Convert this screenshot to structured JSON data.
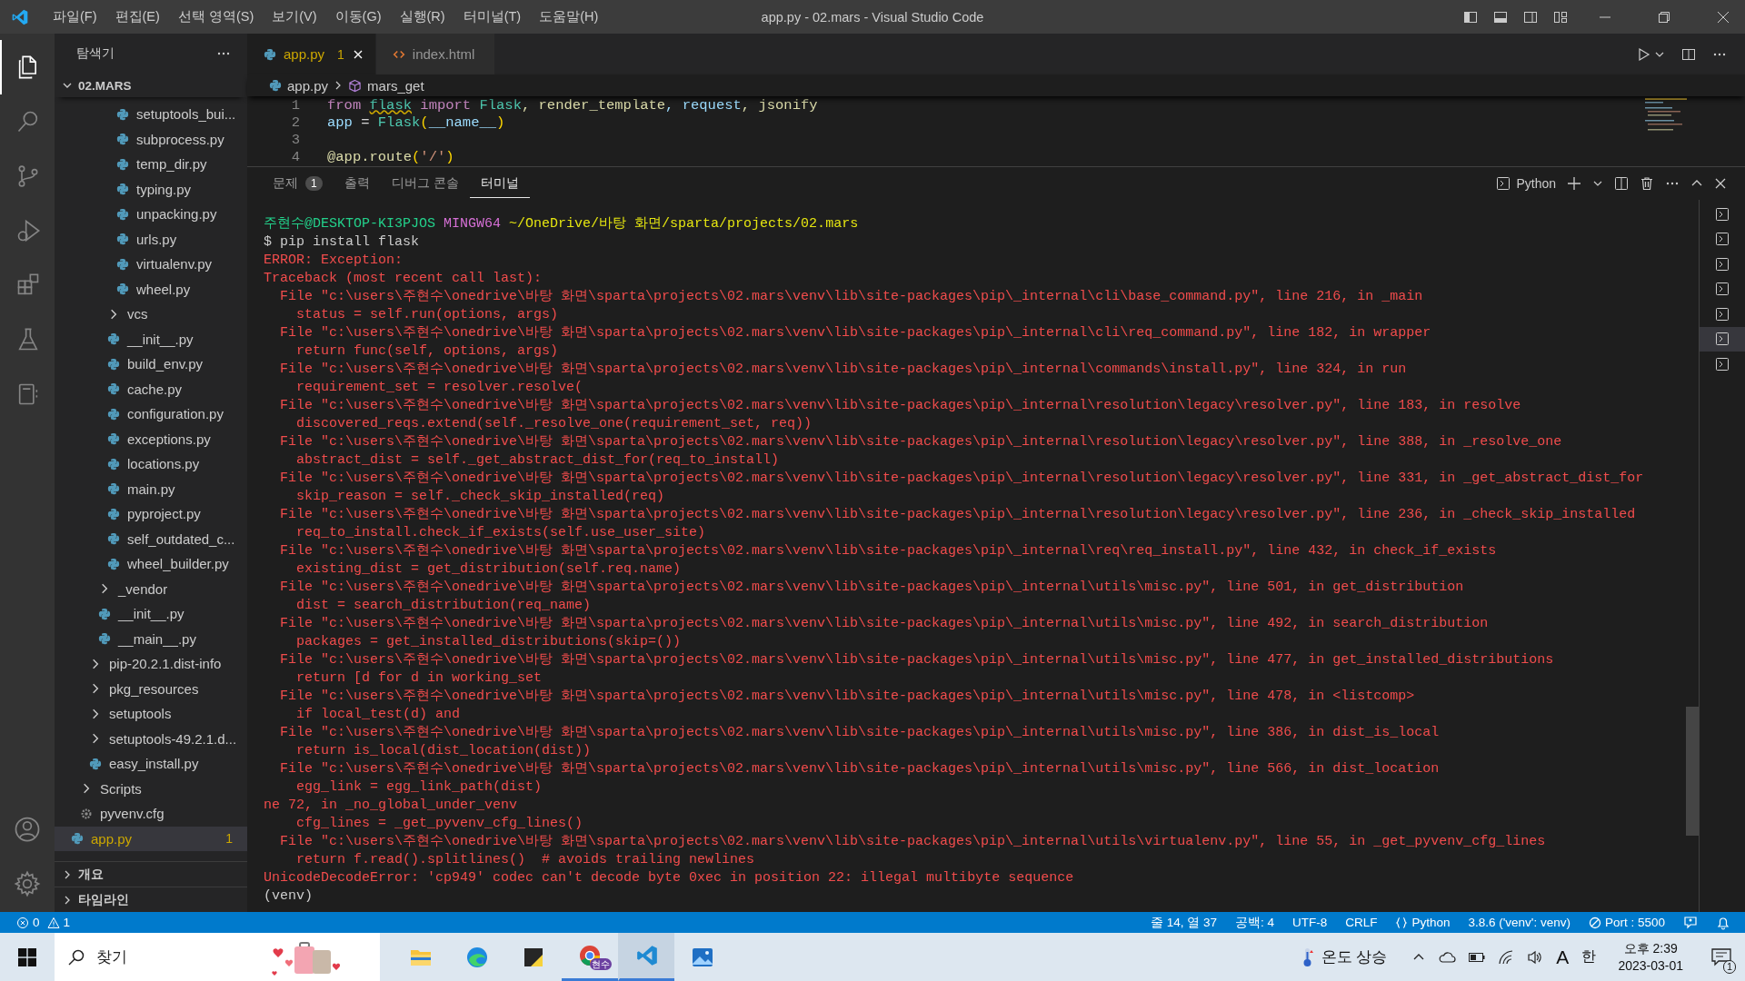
{
  "window": {
    "title": "app.py - 02.mars - Visual Studio Code"
  },
  "menu": [
    "파일(F)",
    "편집(E)",
    "선택 영역(S)",
    "보기(V)",
    "이동(G)",
    "실행(R)",
    "터미널(T)",
    "도움말(H)"
  ],
  "activity_bar": {
    "items": [
      {
        "kind": "explorer",
        "selected": true
      },
      {
        "kind": "search",
        "selected": false
      },
      {
        "kind": "scm",
        "selected": false
      },
      {
        "kind": "debug",
        "selected": false
      },
      {
        "kind": "extensions",
        "selected": false
      },
      {
        "kind": "testing",
        "selected": false
      },
      {
        "kind": "notebook",
        "selected": false
      }
    ]
  },
  "sidebar": {
    "title": "탐색기",
    "folder": "02.MARS",
    "tree": [
      {
        "children": [
          {
            "children": [
              {
                "children": [
                  {
                    "children": [
                      {
                        "children": [
                          {
                            "label": "setuptools_bui...",
                            "kind": "file"
                          },
                          {
                            "label": "subprocess.py",
                            "kind": "file"
                          },
                          {
                            "label": "temp_dir.py",
                            "kind": "file"
                          },
                          {
                            "label": "typing.py",
                            "kind": "file"
                          },
                          {
                            "label": "unpacking.py",
                            "kind": "file"
                          },
                          {
                            "label": "urls.py",
                            "kind": "file"
                          },
                          {
                            "label": "virtualenv.py",
                            "kind": "file"
                          },
                          {
                            "label": "wheel.py",
                            "kind": "file"
                          }
                        ]
                      },
                      {
                        "label": "vcs",
                        "kind": "folder",
                        "expanded": false
                      },
                      {
                        "label": "__init__.py",
                        "kind": "file"
                      },
                      {
                        "label": "build_env.py",
                        "kind": "file"
                      },
                      {
                        "label": "cache.py",
                        "kind": "file"
                      },
                      {
                        "label": "configuration.py",
                        "kind": "file"
                      },
                      {
                        "label": "exceptions.py",
                        "kind": "file"
                      },
                      {
                        "label": "locations.py",
                        "kind": "file"
                      },
                      {
                        "label": "main.py",
                        "kind": "file"
                      },
                      {
                        "label": "pyproject.py",
                        "kind": "file"
                      },
                      {
                        "label": "self_outdated_c...",
                        "kind": "file"
                      },
                      {
                        "label": "wheel_builder.py",
                        "kind": "file"
                      }
                    ]
                  },
                  {
                    "label": "_vendor",
                    "kind": "folder",
                    "expanded": false
                  },
                  {
                    "label": "__init__.py",
                    "kind": "file"
                  },
                  {
                    "label": "__main__.py",
                    "kind": "file"
                  }
                ]
              },
              {
                "label": "pip-20.2.1.dist-info",
                "kind": "folder",
                "expanded": false
              },
              {
                "label": "pkg_resources",
                "kind": "folder",
                "expanded": false
              },
              {
                "label": "setuptools",
                "kind": "folder",
                "expanded": false
              },
              {
                "label": "setuptools-49.2.1.d...",
                "kind": "folder",
                "expanded": false
              },
              {
                "label": "easy_install.py",
                "kind": "file"
              }
            ]
          },
          {
            "label": "Scripts",
            "kind": "folder",
            "expanded": false
          },
          {
            "label": "pyvenv.cfg",
            "kind": "config"
          }
        ]
      },
      {
        "label": "app.py",
        "kind": "file",
        "selected": true,
        "warning": true,
        "badge": "1"
      }
    ],
    "sections": [
      {
        "label": "개요",
        "expanded": false
      },
      {
        "label": "타임라인",
        "expanded": false
      }
    ]
  },
  "editor": {
    "tabs": [
      {
        "label": "app.py",
        "kind": "python",
        "selected": true,
        "warning": true,
        "badge": "1"
      },
      {
        "label": "index.html",
        "kind": "html",
        "selected": false
      }
    ],
    "breadcrumb": [
      {
        "label": "app.py",
        "kind": "python"
      },
      {
        "label": "mars_get",
        "kind": "symbol"
      }
    ],
    "lines": [
      {
        "number": "1",
        "tokens": [
          {
            "text": "from ",
            "kind": "keyword"
          },
          {
            "text": "flask",
            "kind": "module",
            "warning": true
          },
          {
            "text": " import ",
            "kind": "keyword"
          },
          {
            "text": "Flask",
            "kind": "cls"
          },
          {
            "text": ", render_template",
            "kind": "func"
          },
          {
            "text": ", request",
            "kind": "var"
          },
          {
            "text": ", jsonify",
            "kind": "func"
          }
        ]
      },
      {
        "number": "2",
        "tokens": [
          {
            "text": "app",
            "kind": "var"
          },
          {
            "text": " = "
          },
          {
            "text": "Flask",
            "kind": "cls"
          },
          {
            "text": "(",
            "kind": "bracket"
          },
          {
            "text": "__name__",
            "kind": "var"
          },
          {
            "text": ")",
            "kind": "bracket"
          }
        ]
      },
      {
        "number": "3"
      },
      {
        "number": "4",
        "tokens": [
          {
            "text": "@app",
            "kind": "decorator"
          },
          {
            "text": ".route",
            "kind": "decorator"
          },
          {
            "text": "(",
            "kind": "bracket"
          },
          {
            "text": "'/'",
            "kind": "string"
          },
          {
            "text": ")",
            "kind": "bracket"
          }
        ]
      }
    ]
  },
  "panel": {
    "tabs": [
      {
        "label": "문제",
        "badge": "1",
        "selected": false
      },
      {
        "label": "출력",
        "selected": false
      },
      {
        "label": "디버그 콘솔",
        "selected": false
      },
      {
        "label": "터미널",
        "selected": true
      }
    ],
    "profile": "Python",
    "terminals": [
      {
        "selected": false
      },
      {
        "selected": false
      },
      {
        "selected": false
      },
      {
        "selected": false
      },
      {
        "selected": false
      },
      {
        "selected": true
      },
      {
        "selected": false
      }
    ],
    "lines": [
      {
        "kind": "prompt",
        "user": "주현수@DESKTOP-KI3PJOS",
        "shell": "MINGW64",
        "path": "~/OneDrive/바탕 화면/sparta/projects/02.mars"
      },
      {
        "kind": "command",
        "text": "$ pip install flask"
      },
      {
        "kind": "error",
        "text": "ERROR: Exception:"
      },
      {
        "kind": "error",
        "text": "Traceback (most recent call last):"
      },
      {
        "kind": "frame",
        "text": "File \"c:\\users\\주현수\\onedrive\\바탕 화면\\sparta\\projects\\02.mars\\venv\\lib\\site-packages\\pip\\_internal\\cli\\base_command.py\", line 216, in _main"
      },
      {
        "kind": "source",
        "text": "status = self.run(options, args)"
      },
      {
        "kind": "frame",
        "text": "File \"c:\\users\\주현수\\onedrive\\바탕 화면\\sparta\\projects\\02.mars\\venv\\lib\\site-packages\\pip\\_internal\\cli\\req_command.py\", line 182, in wrapper"
      },
      {
        "kind": "source",
        "text": "return func(self, options, args)"
      },
      {
        "kind": "frame",
        "text": "File \"c:\\users\\주현수\\onedrive\\바탕 화면\\sparta\\projects\\02.mars\\venv\\lib\\site-packages\\pip\\_internal\\commands\\install.py\", line 324, in run"
      },
      {
        "kind": "source",
        "text": "requirement_set = resolver.resolve("
      },
      {
        "kind": "frame",
        "text": "File \"c:\\users\\주현수\\onedrive\\바탕 화면\\sparta\\projects\\02.mars\\venv\\lib\\site-packages\\pip\\_internal\\resolution\\legacy\\resolver.py\", line 183, in resolve"
      },
      {
        "kind": "source",
        "text": "discovered_reqs.extend(self._resolve_one(requirement_set, req))"
      },
      {
        "kind": "frame",
        "text": "File \"c:\\users\\주현수\\onedrive\\바탕 화면\\sparta\\projects\\02.mars\\venv\\lib\\site-packages\\pip\\_internal\\resolution\\legacy\\resolver.py\", line 388, in _resolve_one"
      },
      {
        "kind": "source",
        "text": "abstract_dist = self._get_abstract_dist_for(req_to_install)"
      },
      {
        "kind": "frame",
        "text": "File \"c:\\users\\주현수\\onedrive\\바탕 화면\\sparta\\projects\\02.mars\\venv\\lib\\site-packages\\pip\\_internal\\resolution\\legacy\\resolver.py\", line 331, in _get_abstract_dist_for"
      },
      {
        "kind": "source",
        "text": "skip_reason = self._check_skip_installed(req)"
      },
      {
        "kind": "frame",
        "text": "File \"c:\\users\\주현수\\onedrive\\바탕 화면\\sparta\\projects\\02.mars\\venv\\lib\\site-packages\\pip\\_internal\\resolution\\legacy\\resolver.py\", line 236, in _check_skip_installed"
      },
      {
        "kind": "source",
        "text": "req_to_install.check_if_exists(self.use_user_site)"
      },
      {
        "kind": "frame",
        "text": "File \"c:\\users\\주현수\\onedrive\\바탕 화면\\sparta\\projects\\02.mars\\venv\\lib\\site-packages\\pip\\_internal\\req\\req_install.py\", line 432, in check_if_exists"
      },
      {
        "kind": "source",
        "text": "existing_dist = get_distribution(self.req.name)"
      },
      {
        "kind": "frame",
        "text": "File \"c:\\users\\주현수\\onedrive\\바탕 화면\\sparta\\projects\\02.mars\\venv\\lib\\site-packages\\pip\\_internal\\utils\\misc.py\", line 501, in get_distribution"
      },
      {
        "kind": "source",
        "text": "dist = search_distribution(req_name)"
      },
      {
        "kind": "frame",
        "text": "File \"c:\\users\\주현수\\onedrive\\바탕 화면\\sparta\\projects\\02.mars\\venv\\lib\\site-packages\\pip\\_internal\\utils\\misc.py\", line 492, in search_distribution"
      },
      {
        "kind": "source",
        "text": "packages = get_installed_distributions(skip=())"
      },
      {
        "kind": "frame",
        "text": "File \"c:\\users\\주현수\\onedrive\\바탕 화면\\sparta\\projects\\02.mars\\venv\\lib\\site-packages\\pip\\_internal\\utils\\misc.py\", line 477, in get_installed_distributions"
      },
      {
        "kind": "source",
        "text": "return [d for d in working_set"
      },
      {
        "kind": "frame",
        "text": "File \"c:\\users\\주현수\\onedrive\\바탕 화면\\sparta\\projects\\02.mars\\venv\\lib\\site-packages\\pip\\_internal\\utils\\misc.py\", line 478, in <listcomp>"
      },
      {
        "kind": "source",
        "text": "if local_test(d) and"
      },
      {
        "kind": "frame",
        "text": "File \"c:\\users\\주현수\\onedrive\\바탕 화면\\sparta\\projects\\02.mars\\venv\\lib\\site-packages\\pip\\_internal\\utils\\misc.py\", line 386, in dist_is_local"
      },
      {
        "kind": "source",
        "text": "return is_local(dist_location(dist))"
      },
      {
        "kind": "frame",
        "text": "File \"c:\\users\\주현수\\onedrive\\바탕 화면\\sparta\\projects\\02.mars\\venv\\lib\\site-packages\\pip\\_internal\\utils\\misc.py\", line 566, in dist_location"
      },
      {
        "kind": "source",
        "text": "egg_link = egg_link_path(dist)"
      },
      {
        "kind": "error",
        "text": "ne 72, in _no_global_under_venv"
      },
      {
        "kind": "source",
        "text": "cfg_lines = _get_pyvenv_cfg_lines()"
      },
      {
        "kind": "frame",
        "text": "File \"c:\\users\\주현수\\onedrive\\바탕 화면\\sparta\\projects\\02.mars\\venv\\lib\\site-packages\\pip\\_internal\\utils\\virtualenv.py\", line 55, in _get_pyvenv_cfg_lines"
      },
      {
        "kind": "source",
        "text": "return f.read().splitlines()  # avoids trailing newlines"
      },
      {
        "kind": "error",
        "text": "UnicodeDecodeError: 'cp949' codec can't decode byte 0xec in position 22: illegal multibyte sequence"
      },
      {
        "kind": "output",
        "text": "(venv)"
      }
    ]
  },
  "status_bar": {
    "errors": "0",
    "warnings": "1",
    "items": [
      {
        "kind": "text",
        "text": "줄 14, 열 37"
      },
      {
        "kind": "text",
        "text": "공백: 4"
      },
      {
        "kind": "text",
        "text": "UTF-8"
      },
      {
        "kind": "text",
        "text": "CRLF"
      },
      {
        "kind": "language",
        "text": "Python"
      },
      {
        "kind": "text",
        "text": "3.8.6 ('venv': venv)"
      },
      {
        "kind": "port",
        "text": "Port : 5500"
      },
      {
        "kind": "feedback"
      },
      {
        "kind": "bell"
      }
    ]
  },
  "taskbar": {
    "search_placeholder": "찾기",
    "apps": [
      {
        "kind": "files",
        "running": false,
        "active": false
      },
      {
        "kind": "edge",
        "running": false,
        "active": false
      },
      {
        "kind": "notes",
        "running": false,
        "active": false
      },
      {
        "kind": "chrome",
        "badge": "현수",
        "running": true,
        "active": false
      },
      {
        "kind": "vscode",
        "running": true,
        "active": true
      },
      {
        "kind": "photos",
        "running": false,
        "active": false
      }
    ],
    "weather": "온도 상승",
    "language": "A",
    "ime": "한",
    "time": "오후 2:39",
    "date": "2023-03-01",
    "notifications": "1"
  }
}
